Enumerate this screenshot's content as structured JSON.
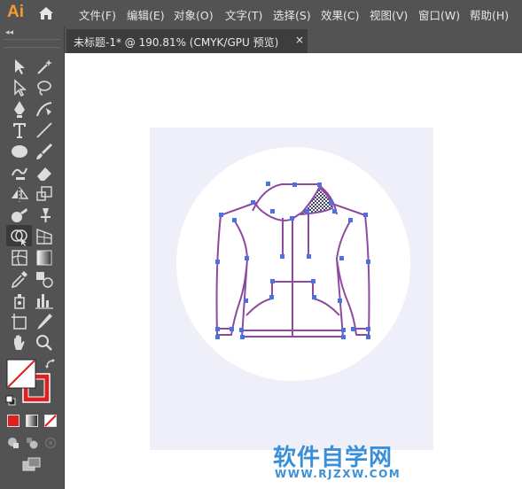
{
  "app": {
    "logo": "Ai"
  },
  "menu": [
    "文件(F)",
    "编辑(E)",
    "对象(O)",
    "文字(T)",
    "选择(S)",
    "效果(C)",
    "视图(V)",
    "窗口(W)",
    "帮助(H)"
  ],
  "toolbar": {
    "collapse_label": "◂◂",
    "tools": [
      "selection-tool",
      "direct-selection-tool",
      "magic-wand-tool",
      "lasso-tool",
      "pen-tool",
      "curvature-tool",
      "type-tool",
      "line-segment-tool",
      "ellipse-tool",
      "paintbrush-tool",
      "shaper-tool",
      "eraser-tool",
      "reflect-tool",
      "scale-tool",
      "warp-tool",
      "puppet-warp-tool",
      "shape-builder-tool",
      "perspective-grid-tool",
      "mesh-tool",
      "gradient-tool",
      "eyedropper-tool",
      "blend-tool",
      "symbol-sprayer-tool",
      "column-graph-tool",
      "artboard-tool",
      "slice-tool",
      "hand-tool",
      "zoom-tool"
    ],
    "active_tool": "shape-builder-tool",
    "fill_stroke": {
      "fill": "none",
      "stroke": "#e02020"
    }
  },
  "document": {
    "tab_title": "未标题-1* @ 190.81% (CMYK/GPU 预览)",
    "close_icon": "×"
  },
  "colors": {
    "path": "#8d4aa0",
    "anchor": "#4a72e0",
    "accent": "#f59a33",
    "watermark": "#3a8fd6"
  },
  "watermark": {
    "title": "软件自学网",
    "url": "WWW.RJZXW.COM"
  }
}
